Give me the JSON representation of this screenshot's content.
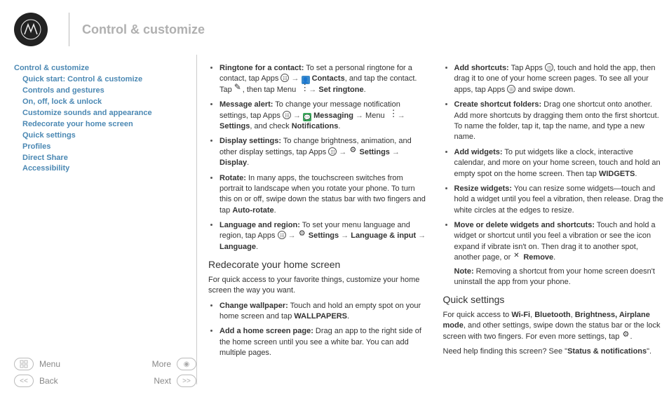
{
  "title": "Control & customize",
  "toc": [
    {
      "label": "Control & customize",
      "sub": false
    },
    {
      "label": "Quick start: Control & customize",
      "sub": true
    },
    {
      "label": "Controls and gestures",
      "sub": true
    },
    {
      "label": "On, off, lock & unlock",
      "sub": true
    },
    {
      "label": "Customize sounds and appearance",
      "sub": true
    },
    {
      "label": "Redecorate your home screen",
      "sub": true
    },
    {
      "label": "Quick settings",
      "sub": true
    },
    {
      "label": "Profiles",
      "sub": true
    },
    {
      "label": "Direct Share",
      "sub": true
    },
    {
      "label": "Accessibility",
      "sub": true
    }
  ],
  "nav": {
    "menu": "Menu",
    "more": "More",
    "back": "Back",
    "next": "Next"
  },
  "c": {
    "li1a": "Ringtone for a contact:",
    "li1b": " To set a personal ringtone for a contact, tap Apps ",
    "li1c": "Contacts",
    "li1d": ", and tap the contact. Tap ",
    "li1e": ", then tap Menu ",
    "li1f": "Set ringtone",
    "li1g": ".",
    "li2a": "Message alert:",
    "li2b": " To change your message notification settings, tap Apps ",
    "li2c": "Messaging",
    "li2d": " Menu ",
    "li2e": "Settings",
    "li2f": ", and check ",
    "li2g": "Notifications",
    "li2h": ".",
    "li3a": "Display settings:",
    "li3b": " To change brightness, animation, and other display settings, tap Apps ",
    "li3c": "Settings",
    "li3d": "Display",
    "li3e": ".",
    "li4a": "Rotate:",
    "li4b": " In many apps, the touchscreen switches from portrait to landscape when you rotate your phone. To turn this on or off, swipe down the status bar with two fingers and tap ",
    "li4c": "Auto-rotate",
    "li4d": ".",
    "li5a": "Language and region:",
    "li5b": " To set your menu language and region, tap Apps ",
    "li5c": "Settings",
    "li5d": "Language & input",
    "li5e": "Language",
    "li5f": ".",
    "h1": "Redecorate your home screen",
    "p1": "For quick access to your favorite things, customize your home screen the way you want.",
    "li6a": "Change wallpaper:",
    "li6b": " Touch and hold an empty spot on your home screen and tap ",
    "li6c": "WALLPAPERS",
    "li6d": ".",
    "li7a": "Add a home screen page:",
    "li7b": " Drag an app to the right side of the home screen until you see a white bar. You can add multiple pages.",
    "li8a": "Add shortcuts:",
    "li8b": " Tap Apps ",
    "li8c": ", touch and hold the app, then drag it to one of your home screen pages. To see all your apps, tap Apps ",
    "li8d": " and swipe down.",
    "li9a": "Create shortcut folders:",
    "li9b": " Drag one shortcut onto another. Add more shortcuts by dragging them onto the first shortcut. To name the folder, tap it, tap the name, and type a new name.",
    "li10a": "Add widgets:",
    "li10b": " To put widgets like a clock, interactive calendar, and more on your home screen, touch and hold an empty spot on the home screen. Then tap ",
    "li10c": "WIDGETS",
    "li10d": ".",
    "li11a": "Resize widgets:",
    "li11b": " You can resize some widgets—touch and hold a widget until you feel a vibration, then release. Drag the white circles at the edges to resize.",
    "li12a": "Move or delete widgets and shortcuts:",
    "li12b": " Touch and hold a widget or shortcut until you feel a vibration or see the icon expand if vibrate isn't on. Then drag it to another spot, another page, or ",
    "li12c": "Remove",
    "li12d": ".",
    "li12e": "Note:",
    "li12f": " Removing a shortcut from your home screen doesn't uninstall the app from your phone.",
    "h2": "Quick settings",
    "p2a": "For quick access to ",
    "p2b": "Wi-Fi",
    "p2c": ", ",
    "p2d": "Bluetooth",
    "p2e": ", ",
    "p2f": "Brightness, Airplane mode",
    "p2g": ", and other settings, swipe down the status bar or the lock screen with two fingers. For even more settings, tap ",
    "p2h": ".",
    "p3a": "Need help finding this screen? See \"",
    "p3b": "Status & notifications",
    "p3c": "\"."
  }
}
